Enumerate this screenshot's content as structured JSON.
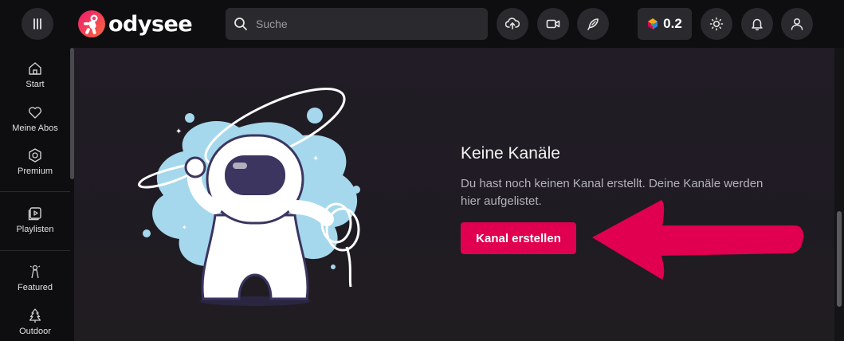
{
  "header": {
    "menu_icon": "menu-icon",
    "logo_text": "odysee",
    "search": {
      "placeholder": "Suche",
      "value": ""
    },
    "actions": [
      "upload-icon",
      "video-camera-icon",
      "feather-pen-icon"
    ],
    "credits_balance": "0.2",
    "right_icons": [
      "sun-icon",
      "bell-icon",
      "user-icon"
    ]
  },
  "sidebar": {
    "items": [
      {
        "label": "Start",
        "icon": "home-icon"
      },
      {
        "label": "Meine Abos",
        "icon": "heart-icon"
      },
      {
        "label": "Premium",
        "icon": "premium-icon"
      },
      {
        "label": "Playlisten",
        "icon": "playlist-icon"
      },
      {
        "label": "Featured",
        "icon": "featured-icon"
      },
      {
        "label": "Outdoor",
        "icon": "tree-icon"
      }
    ]
  },
  "main": {
    "title": "Keine Kanäle",
    "description": "Du hast noch keinen Kanal erstellt. Deine Kanäle werden hier aufgelistet.",
    "create_button": "Kanal erstellen"
  },
  "colors": {
    "accent": "#e0004f",
    "arrow": "#e0004f",
    "header_bg": "#0e0e10",
    "main_bg": "#211c25",
    "button_bg": "#2a2a2e"
  }
}
